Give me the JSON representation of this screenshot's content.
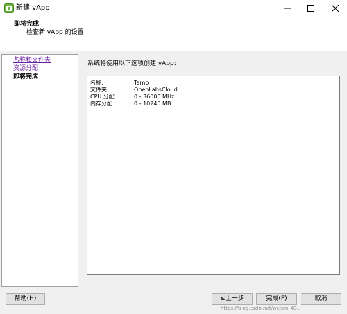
{
  "window": {
    "title": "新建 vApp",
    "icon": "vmware-vapp-icon",
    "controls": [
      "minimize-icon",
      "maximize-icon",
      "close-icon"
    ]
  },
  "header": {
    "title": "即将完成",
    "subtitle": "检查新 vApp 的设置"
  },
  "steps": [
    {
      "label": "名称和文件夹",
      "state": "link"
    },
    {
      "label": "资源分配",
      "state": "link"
    },
    {
      "label": "即将完成",
      "state": "current"
    }
  ],
  "main": {
    "intro": "系统将使用以下选项创建 vApp:",
    "summary": [
      {
        "label": "名称:",
        "value": "Temp"
      },
      {
        "label": "文件夹:",
        "value": "OpenLabsCloud"
      },
      {
        "label": "CPU 分配:",
        "value": "0 - 36000 MHz"
      },
      {
        "label": "内存分配:",
        "value": "0 - 10240 MB"
      }
    ]
  },
  "buttons": {
    "help": "帮助(H)",
    "back": "≤上一步",
    "finish": "完成(F)",
    "cancel": "取消"
  },
  "watermark": "https://blog.csdn.net/weixin_43..."
}
